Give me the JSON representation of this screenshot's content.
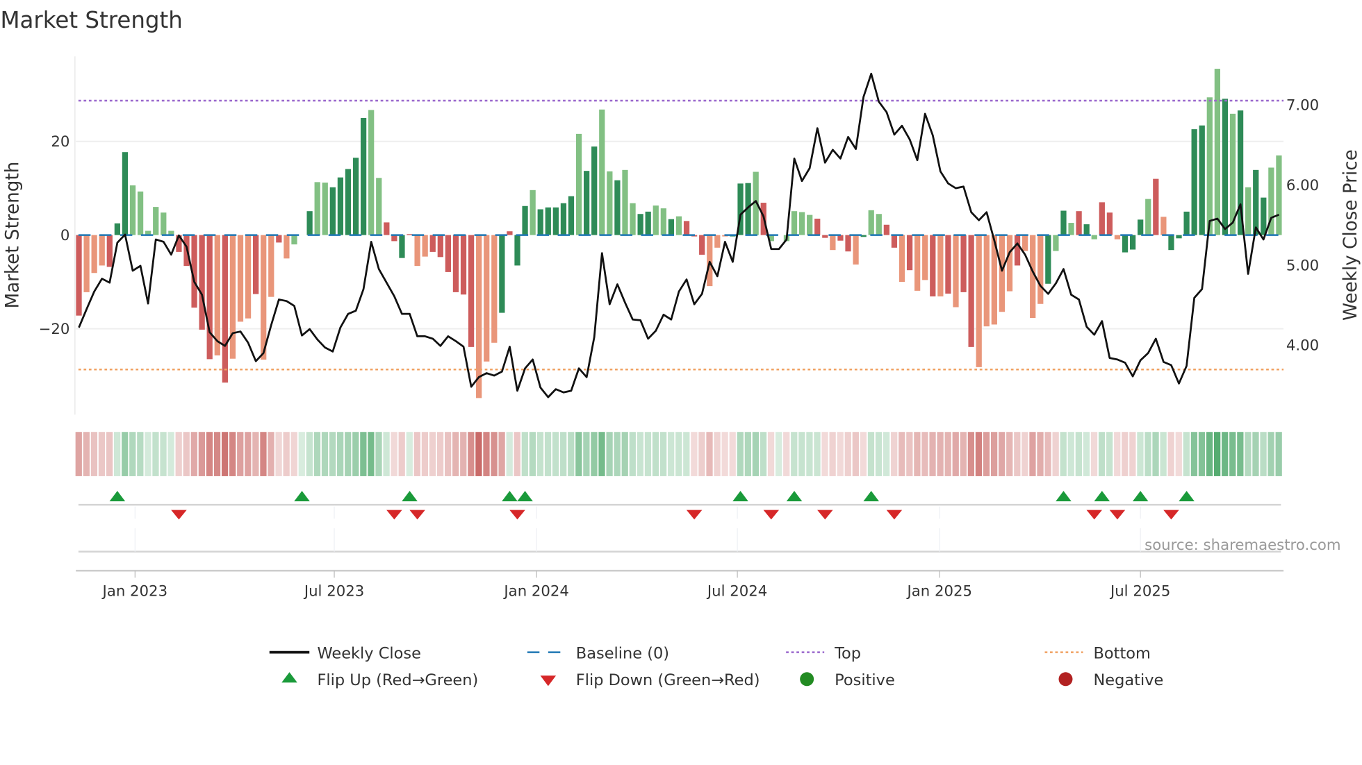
{
  "chart_data": {
    "type": "bar",
    "title": "Market Strength",
    "ylabel_left": "Market Strength",
    "ylabel_right": "Weekly Close Price",
    "left_ticks": [
      {
        "value": 20,
        "label": "20"
      },
      {
        "value": 0,
        "label": "0"
      },
      {
        "value": -20,
        "label": "−20"
      }
    ],
    "right_ticks": [
      {
        "value": 7,
        "label": "7.00"
      },
      {
        "value": 6,
        "label": "6.00"
      },
      {
        "value": 5,
        "label": "5.00"
      },
      {
        "value": 4,
        "label": "4.00"
      }
    ],
    "x_ticks": [
      {
        "week_index": 7.3,
        "label": "Jan 2023"
      },
      {
        "week_index": 33.2,
        "label": "Jul 2023"
      },
      {
        "week_index": 59.5,
        "label": "Jan 2024"
      },
      {
        "week_index": 85.6,
        "label": "Jul 2024"
      },
      {
        "week_index": 111.9,
        "label": "Jan 2025"
      },
      {
        "week_index": 138.0,
        "label": "Jul 2025"
      }
    ],
    "top_level": 28.7,
    "bottom_level": -28.7,
    "baseline": 0,
    "strength": [
      -17.2,
      -12.2,
      -8.1,
      -6.5,
      -6.8,
      2.5,
      17.7,
      10.6,
      9.3,
      0.9,
      6.0,
      4.8,
      0.9,
      -3.6,
      -6.6,
      -15.5,
      -20.2,
      -26.5,
      -25.7,
      -31.5,
      -26.4,
      -18.5,
      -17.8,
      -12.6,
      -26.6,
      -13.2,
      -1.6,
      -5.0,
      -2.0,
      0,
      5.1,
      11.3,
      11.2,
      10.2,
      12.3,
      14.1,
      16.5,
      25.0,
      26.7,
      12.2,
      2.7,
      -1.3,
      -4.9,
      0.2,
      -6.6,
      -4.6,
      -3.6,
      -4.7,
      -7.9,
      -12.2,
      -12.7,
      -23.9,
      -34.8,
      -27.0,
      -23.0,
      -16.6,
      0.8,
      -6.5,
      6.2,
      9.6,
      5.5,
      5.9,
      5.9,
      6.8,
      8.3,
      21.6,
      13.7,
      18.9,
      26.8,
      13.6,
      11.7,
      13.9,
      6.8,
      4.5,
      5.0,
      6.3,
      5.7,
      3.4,
      4.0,
      3.0,
      -0.3,
      -4.2,
      -10.9,
      -2.7,
      -0.3,
      -0.3,
      11.0,
      11.1,
      13.5,
      6.9,
      -1.3,
      0,
      -1.3,
      5.1,
      4.9,
      4.3,
      3.5,
      -0.6,
      -3.2,
      -1.2,
      -3.5,
      -6.3,
      -0.4,
      5.3,
      4.5,
      2.2,
      -2.7,
      -10.0,
      -7.5,
      -11.9,
      -9.6,
      -13.1,
      -13.1,
      -12.5,
      -15.4,
      -12.2,
      -23.9,
      -28.2,
      -19.5,
      -19.1,
      -16.4,
      -12.0,
      -6.5,
      -3.4,
      -17.7,
      -14.7,
      -10.4,
      -3.4,
      5.2,
      2.6,
      5.1,
      2.3,
      -0.9,
      7.0,
      4.8,
      -0.9,
      -3.7,
      -3.1,
      3.3,
      7.7,
      12.0,
      3.9,
      -3.2,
      -0.7,
      5.0,
      22.6,
      23.4,
      29.4,
      35.5,
      29.1,
      25.9,
      26.6,
      10.2,
      13.9,
      8.0,
      14.4,
      17.0
    ],
    "shade": "RrrrRGGggggggRRRRRrRrrrRrrRr-GGggGGGGGggRRGRrrRRRRRRrrrGRGGgGGGGGgGGggGggGGggGgRRRrrrGGGgR-RggggRRrRRrGggRRrRrrRrRrRRrrrrrRrrrGgGgRGgRRrGGGgRrGGGGGggGgGgGG",
    "weekly_close": [
      4.22,
      4.45,
      4.67,
      4.83,
      4.78,
      5.28,
      5.38,
      4.93,
      4.99,
      4.52,
      5.32,
      5.29,
      5.13,
      5.37,
      5.23,
      4.79,
      4.63,
      4.16,
      4.05,
      3.99,
      4.15,
      4.17,
      4.03,
      3.8,
      3.9,
      4.25,
      4.57,
      4.55,
      4.49,
      4.12,
      4.2,
      4.07,
      3.97,
      3.92,
      4.22,
      4.39,
      4.43,
      4.7,
      5.29,
      4.95,
      4.78,
      4.61,
      4.39,
      4.39,
      4.11,
      4.11,
      4.08,
      3.99,
      4.11,
      4.05,
      3.98,
      3.48,
      3.6,
      3.65,
      3.62,
      3.67,
      3.98,
      3.43,
      3.71,
      3.82,
      3.47,
      3.35,
      3.45,
      3.41,
      3.43,
      3.71,
      3.6,
      4.1,
      5.15,
      4.51,
      4.76,
      4.53,
      4.32,
      4.31,
      4.08,
      4.18,
      4.38,
      4.32,
      4.67,
      4.82,
      4.51,
      4.64,
      5.04,
      4.86,
      5.29,
      5.04,
      5.63,
      5.72,
      5.8,
      5.61,
      5.2,
      5.2,
      5.32,
      6.33,
      6.05,
      6.21,
      6.71,
      6.28,
      6.44,
      6.33,
      6.6,
      6.45,
      7.1,
      7.39,
      7.04,
      6.91,
      6.63,
      6.74,
      6.57,
      6.31,
      6.89,
      6.62,
      6.17,
      6.02,
      5.96,
      5.98,
      5.66,
      5.56,
      5.66,
      5.31,
      4.93,
      5.16,
      5.27,
      5.13,
      4.92,
      4.74,
      4.64,
      4.77,
      4.95,
      4.63,
      4.57,
      4.23,
      4.13,
      4.3,
      3.84,
      3.82,
      3.78,
      3.61,
      3.81,
      3.9,
      4.08,
      3.79,
      3.75,
      3.52,
      3.74,
      4.59,
      4.7,
      5.55,
      5.58,
      5.45,
      5.53,
      5.76,
      4.89,
      5.47,
      5.32,
      5.59,
      5.63
    ],
    "flip_up_weeks": [
      5,
      29,
      43,
      56,
      58,
      86,
      93,
      103,
      128,
      133,
      138,
      144
    ],
    "flip_down_weeks": [
      13,
      41,
      44,
      57,
      80,
      90,
      97,
      106,
      132,
      135,
      142
    ],
    "colors": {
      "green_dark": "#2e8b57",
      "green_light": "#82c083",
      "red_dark": "#cd5c5c",
      "red_light": "#e9967a",
      "line": "#111111",
      "baseline": "#1f77b4",
      "top": "#9966cc",
      "bottom": "#f0a060",
      "flip_up": "#1a9a3a",
      "flip_down": "#d62728",
      "positive": "#228b22",
      "negative": "#b22222"
    },
    "legend": {
      "weekly_close": "Weekly Close",
      "baseline": "Baseline (0)",
      "top": "Top",
      "bottom": "Bottom",
      "flip_up": "Flip Up (Red→Green)",
      "flip_down": "Flip Down (Green→Red)",
      "positive": "Positive",
      "negative": "Negative"
    },
    "legend_placement": "bottom",
    "source": "source: sharemaestro.com"
  }
}
